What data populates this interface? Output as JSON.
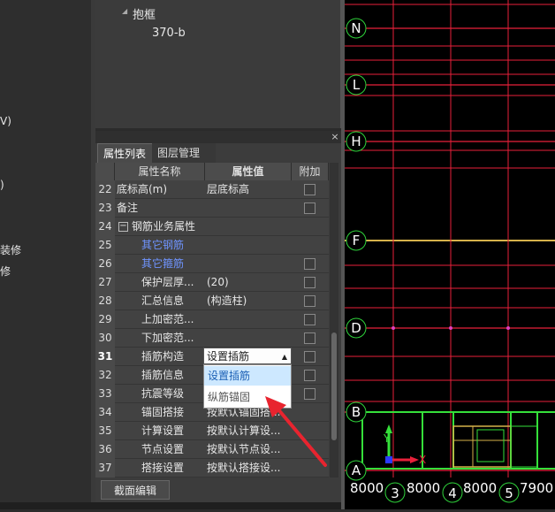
{
  "left_strip": {
    "fragments": [
      "V)",
      ")",
      "装修",
      "修"
    ]
  },
  "tree": {
    "parent": "抱框",
    "child": "370-b",
    "expander": "◢"
  },
  "panel": {
    "close": "×",
    "tabs": [
      "属性列表",
      "图层管理"
    ],
    "headers": {
      "name": "属性名称",
      "value": "属性值",
      "extra": "附加"
    },
    "rows": [
      {
        "num": "22",
        "name": "底标高(m)",
        "value": "层底标高",
        "check": true
      },
      {
        "num": "23",
        "name": "备注",
        "value": "",
        "check": true
      },
      {
        "num": "24",
        "name": "钢筋业务属性",
        "value": "",
        "check": false,
        "group": true
      },
      {
        "num": "25",
        "name": "其它钢筋",
        "value": "",
        "check": false,
        "blue": true
      },
      {
        "num": "26",
        "name": "其它箍筋",
        "value": "",
        "check": true,
        "blue": true
      },
      {
        "num": "27",
        "name": "保护层厚...",
        "value": "(20)",
        "check": true
      },
      {
        "num": "28",
        "name": "汇总信息",
        "value": "(构造柱)",
        "check": true
      },
      {
        "num": "29",
        "name": "上加密范...",
        "value": "",
        "check": true
      },
      {
        "num": "30",
        "name": "下加密范...",
        "value": "",
        "check": true
      },
      {
        "num": "31",
        "name": "插筋构造",
        "value": "",
        "check": true,
        "current": true
      },
      {
        "num": "32",
        "name": "插筋信息",
        "value": "",
        "check": true
      },
      {
        "num": "33",
        "name": "抗震等级",
        "value": "",
        "check": true
      },
      {
        "num": "34",
        "name": "锚固搭接",
        "value": "按默认锚固搭...",
        "check": false
      },
      {
        "num": "35",
        "name": "计算设置",
        "value": "按默认计算设...",
        "check": false
      },
      {
        "num": "36",
        "name": "节点设置",
        "value": "按默认节点设...",
        "check": false
      },
      {
        "num": "37",
        "name": "搭接设置",
        "value": "按默认搭接设...",
        "check": false
      }
    ],
    "combo": {
      "value": "设置插筋",
      "arrow": "▲"
    },
    "dropdown_options": [
      "设置插筋",
      "纵筋锚固"
    ],
    "section_edit_button": "截面编辑"
  },
  "cad": {
    "axis_labels_left": [
      "N",
      "L",
      "H",
      "F",
      "D",
      "B",
      "A"
    ],
    "axis_labels_bottom": [
      "3",
      "4",
      "5"
    ],
    "dimensions": [
      "8000",
      "8000",
      "8000",
      "7900"
    ],
    "ucs": {
      "x": "X",
      "y": "Y"
    },
    "colors": {
      "grid": "#e8203a",
      "axis_circle": "#2fd33b",
      "wall": "#35e03a",
      "beam": "#d6b24a"
    }
  }
}
